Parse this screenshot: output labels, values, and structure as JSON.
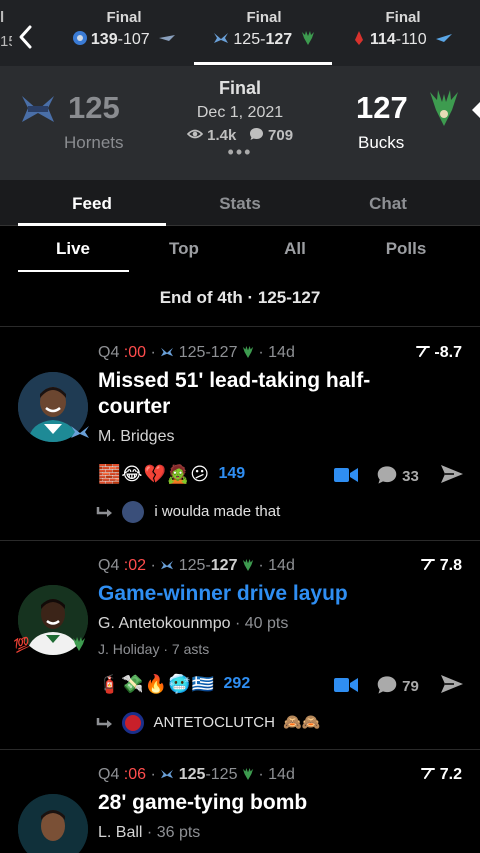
{
  "strip": {
    "left_partial": {
      "status": "l",
      "score": "15"
    },
    "games": [
      {
        "status": "Final",
        "score_a": "139",
        "score_b": "107",
        "winner": "a"
      },
      {
        "status": "Final",
        "score_a": "125",
        "score_b": "127",
        "winner": "b"
      },
      {
        "status": "Final",
        "score_a": "114",
        "score_b": "110",
        "winner": "a"
      }
    ]
  },
  "header": {
    "home_score": "125",
    "home_team": "Hornets",
    "away_score": "127",
    "away_team": "Bucks",
    "status": "Final",
    "date": "Dec 1, 2021",
    "views": "1.4k",
    "comments": "709",
    "more": "•••"
  },
  "tabs": [
    "Feed",
    "Stats",
    "Chat"
  ],
  "subtabs": [
    "Live",
    "Top",
    "All",
    "Polls"
  ],
  "period_summary": "End of 4th · 125-127",
  "plays": [
    {
      "quarter": "Q4",
      "clock": ":00",
      "score_a": "125",
      "score_b": "127",
      "bold_side": "none",
      "age": "14d",
      "win_prob": "-8.7",
      "title": "Missed 51' lead-taking half-courter",
      "player": "M. Bridges",
      "reactions": "🧱😂💔🧟😕",
      "reaction_count": "149",
      "comment_count": "33",
      "reply": "i woulda made that",
      "highlight": false
    },
    {
      "quarter": "Q4",
      "clock": ":02",
      "score_a": "125",
      "score_b": "127",
      "bold_side": "b",
      "age": "14d",
      "win_prob": "7.8",
      "title": "Game-winner drive layup",
      "player": "G. Antetokounmpo",
      "player_stat": "40 pts",
      "assist": "J. Holiday · 7 asts",
      "reactions": "🧯💸🔥🥶🇬🇷",
      "reaction_count": "292",
      "comment_count": "79",
      "reply": "ANTETOCLUTCH",
      "reply_emoji": "🙈🙈",
      "highlight": true
    },
    {
      "quarter": "Q4",
      "clock": ":06",
      "score_a": "125",
      "score_b": "125",
      "bold_side": "a",
      "age": "14d",
      "win_prob": "7.2",
      "title": "28' game-tying bomb",
      "player": "L. Ball",
      "player_stat": "36 pts"
    }
  ],
  "colors": {
    "accent_blue": "#2f8ef2",
    "clock_red": "#ff4d4d",
    "header_bg": "#2b2d30",
    "strip_bg": "#202225"
  }
}
